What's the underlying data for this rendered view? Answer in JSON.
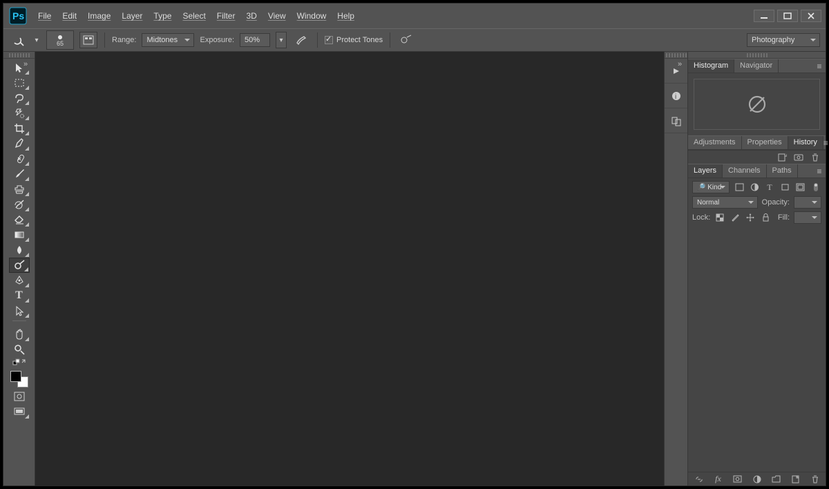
{
  "menus": [
    "File",
    "Edit",
    "Image",
    "Layer",
    "Type",
    "Select",
    "Filter",
    "3D",
    "View",
    "Window",
    "Help"
  ],
  "workspace": "Photography",
  "options": {
    "brush_size": "65",
    "range_label": "Range:",
    "range_value": "Midtones",
    "exposure_label": "Exposure:",
    "exposure_value": "50%",
    "protect_tones_label": "Protect Tones"
  },
  "panels": {
    "top_tabs": [
      "Histogram",
      "Navigator"
    ],
    "top_active": "Histogram",
    "mid_tabs": [
      "Adjustments",
      "Properties",
      "History"
    ],
    "mid_active": "History",
    "bottom_tabs": [
      "Layers",
      "Channels",
      "Paths"
    ],
    "bottom_active": "Layers",
    "layers": {
      "filter_label": "Kind",
      "blend_mode": "Normal",
      "opacity_label": "Opacity:",
      "opacity_value": "",
      "lock_label": "Lock:",
      "fill_label": "Fill:",
      "fill_value": ""
    }
  }
}
